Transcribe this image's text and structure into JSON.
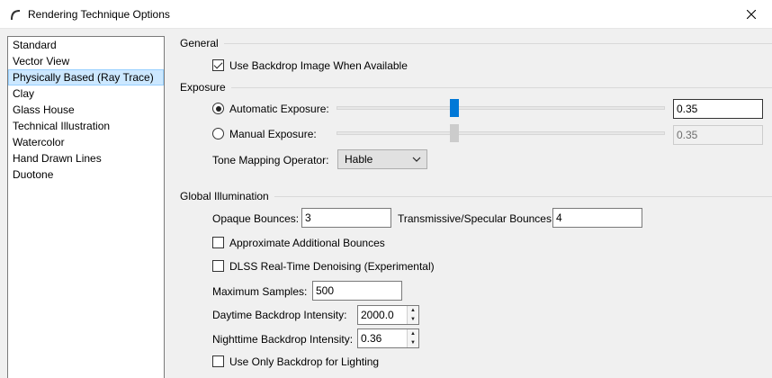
{
  "window": {
    "title": "Rendering Technique Options"
  },
  "techniques": [
    "Standard",
    "Vector View",
    "Physically Based (Ray Trace)",
    "Clay",
    "Glass House",
    "Technical Illustration",
    "Watercolor",
    "Hand Drawn Lines",
    "Duotone"
  ],
  "general": {
    "label": "General",
    "use_backdrop_label": "Use Backdrop Image When Available",
    "use_backdrop_checked": true
  },
  "exposure": {
    "label": "Exposure",
    "automatic_label": "Automatic Exposure:",
    "automatic_value": "0.35",
    "automatic_selected": true,
    "manual_label": "Manual Exposure:",
    "manual_value": "0.35",
    "manual_selected": false,
    "tone_mapping_label": "Tone Mapping Operator:",
    "tone_mapping_value": "Hable"
  },
  "global_illumination": {
    "label": "Global Illumination",
    "opaque_bounces_label": "Opaque Bounces:",
    "opaque_bounces_value": "3",
    "transmissive_bounces_label": "Transmissive/Specular Bounces:",
    "transmissive_bounces_value": "4",
    "approx_bounces_label": "Approximate Additional Bounces",
    "approx_bounces_checked": false,
    "dlss_label": "DLSS Real-Time Denoising (Experimental)",
    "dlss_checked": false,
    "max_samples_label": "Maximum Samples:",
    "max_samples_value": "500",
    "daytime_label": "Daytime Backdrop Intensity:",
    "daytime_value": "2000.0",
    "nighttime_label": "Nighttime Backdrop Intensity:",
    "nighttime_value": "0.36",
    "backdrop_lighting_label": "Use Only Backdrop for Lighting",
    "backdrop_lighting_checked": false
  },
  "colors": {
    "accent": "#0078d7",
    "selection": "#cce8ff"
  }
}
